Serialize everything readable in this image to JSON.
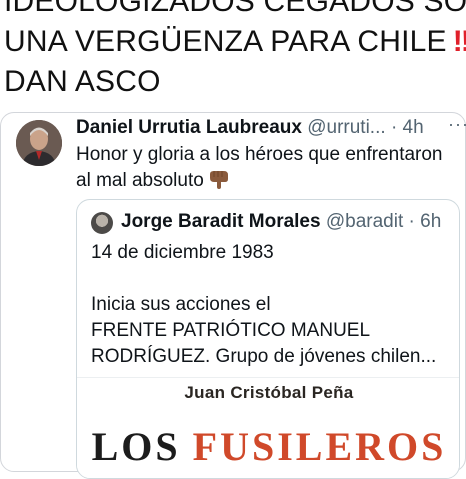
{
  "headline": {
    "line1": "IDEOLOGIZADOS CEGADOS SON",
    "line2": "UNA VERGÜENZA PARA CHILE",
    "line2_emoji": "!!",
    "line3": "DAN ASCO"
  },
  "tweet": {
    "author_name": "Daniel Urrutia Laubreaux",
    "handle": "@urruti...",
    "separator": "·",
    "age": "4h",
    "more": "···",
    "text": "Honor y gloria a los héroes que enfrentaron al mal absoluto"
  },
  "quote": {
    "author_name": "Jorge Baradit Morales",
    "handle": "@baradit",
    "separator": "·",
    "age": "6h",
    "date_line": "14 de diciembre 1983",
    "body_line1": "Inicia sus acciones el",
    "body_line2": "FRENTE PATRIÓTICO MANUEL",
    "body_line3": "RODRÍGUEZ. Grupo de jóvenes chilen...",
    "book_author": "Juan Cristóbal Peña",
    "book_title_w1": "LOS",
    "book_title_w2": "FUSILEROS"
  },
  "colors": {
    "text": "#0f1419",
    "muted": "#536471",
    "border": "#cfd9de",
    "alert_red": "#e0202a",
    "book_orange": "#d0492a"
  },
  "icons": {
    "pointing_hand": "backhand-index-pointing-down-emoji",
    "double_exclamation": "double-exclamation-emoji"
  }
}
